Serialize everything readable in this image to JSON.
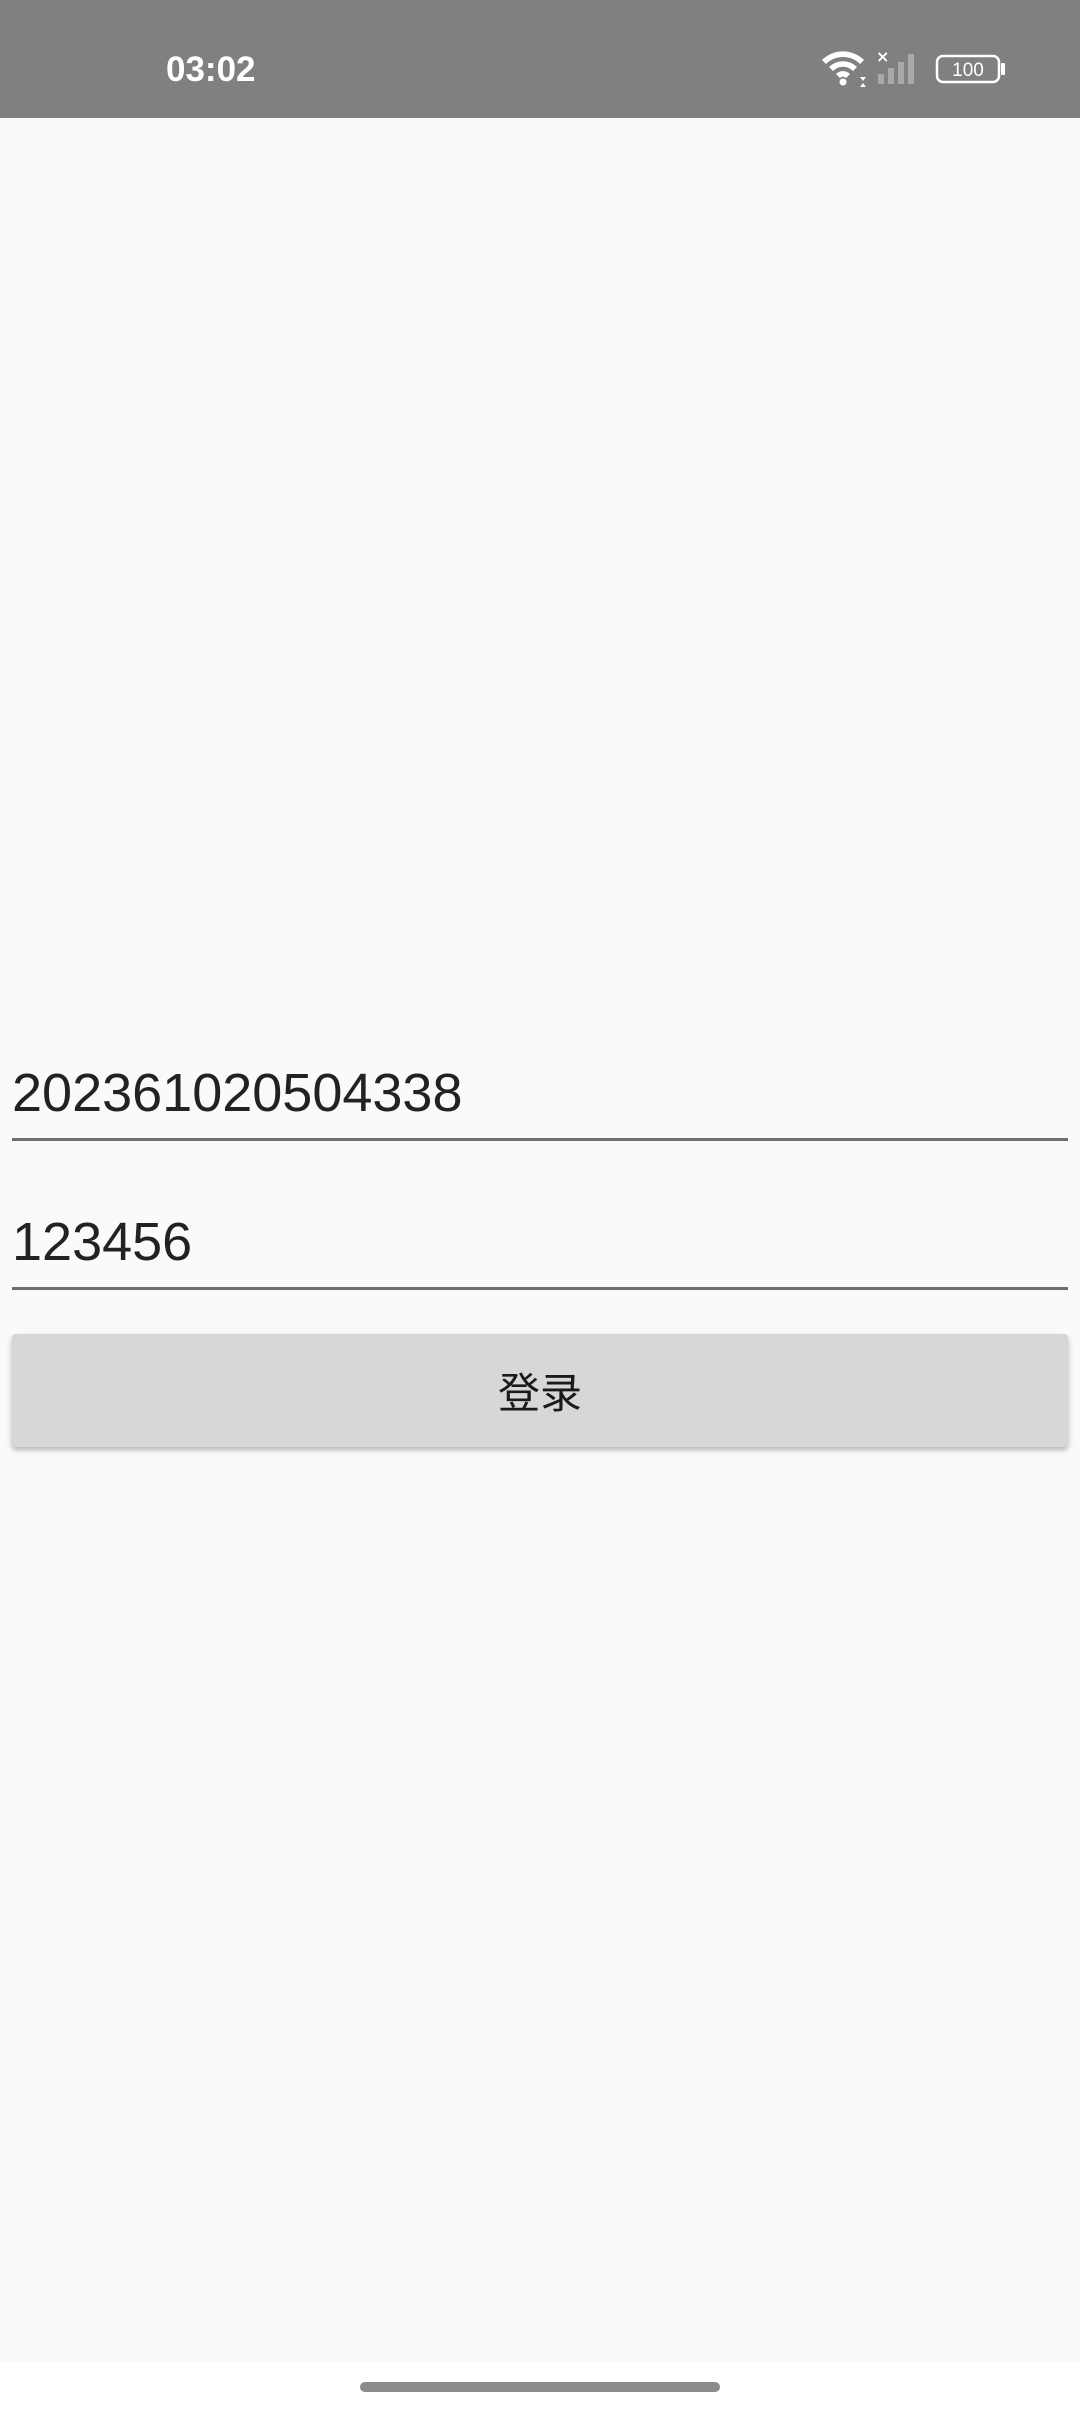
{
  "status_bar": {
    "time": "03:02",
    "battery": "100",
    "icons": [
      "wifi-icon",
      "signal-no-service-icon",
      "battery-icon"
    ]
  },
  "login_form": {
    "account_value": "202361020504338",
    "password_value": "123456",
    "login_label": "登录"
  },
  "colors": {
    "status_bar_bg": "#808080",
    "page_bg": "#fafafa",
    "button_bg": "#d6d7d7",
    "underline": "#6e6e6e"
  }
}
